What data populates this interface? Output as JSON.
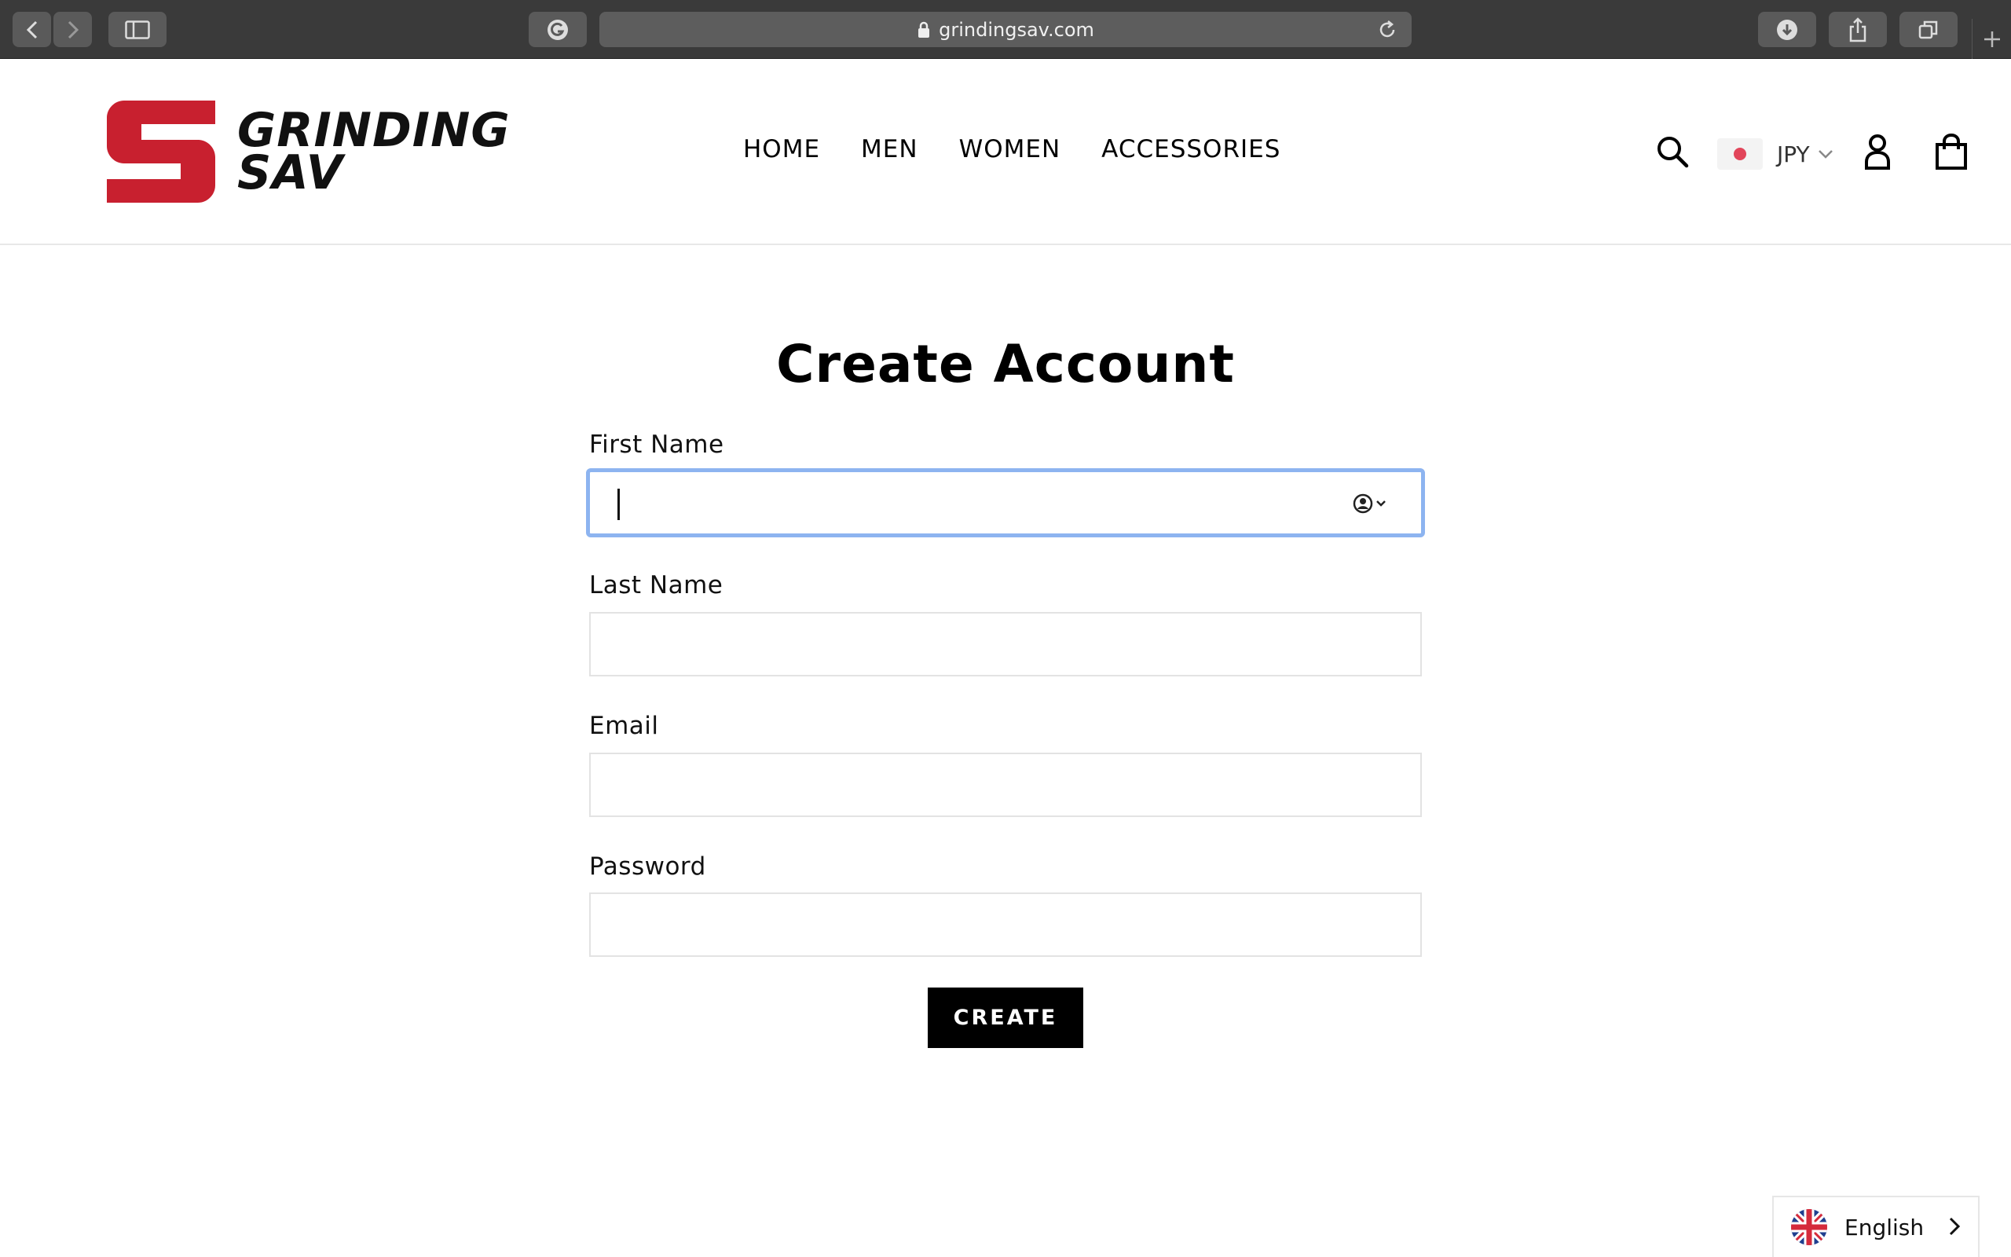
{
  "browser": {
    "url": "grindingsav.com"
  },
  "brand": {
    "name_line1": "GRINDING",
    "name_line2": "SAV",
    "accent_color": "#c8202f"
  },
  "nav": {
    "items": [
      {
        "label": "HOME"
      },
      {
        "label": "MEN"
      },
      {
        "label": "WOMEN"
      },
      {
        "label": "ACCESSORIES"
      }
    ]
  },
  "header": {
    "currency": "JPY",
    "icons": [
      "search-icon",
      "account-icon",
      "cart-icon"
    ]
  },
  "form": {
    "title": "Create Account",
    "fields": [
      {
        "label": "First Name",
        "value": "",
        "focused": true
      },
      {
        "label": "Last Name",
        "value": ""
      },
      {
        "label": "Email",
        "value": ""
      },
      {
        "label": "Password",
        "value": ""
      }
    ],
    "submit_label": "CREATE"
  },
  "language": {
    "label": "English"
  }
}
